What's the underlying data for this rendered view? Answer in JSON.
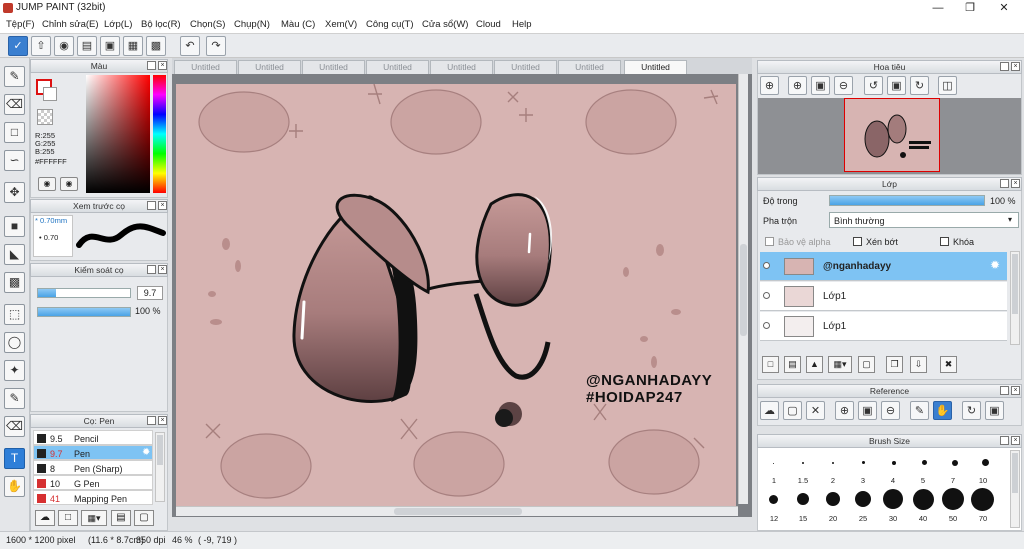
{
  "app": {
    "title": "JUMP PAINT (32bit)"
  },
  "menu": [
    "Tệp(F)",
    "Chỉnh sửa(E)",
    "Lớp(L)",
    "Bộ lọc(R)",
    "Chọn(S)",
    "Chụp(N)",
    "Màu (C)",
    "Xem(V)",
    "Công cụ(T)",
    "Cửa sổ(W)",
    "Cloud",
    "Help"
  ],
  "color_panel": {
    "title": "Màu",
    "r": "R:255",
    "g": "G:255",
    "b": "B:255",
    "hex": "#FFFFFF"
  },
  "preview_panel": {
    "title": "Xem trước cọ",
    "size": "* 0.70mm",
    "dot": "• 0.70"
  },
  "brush_control": {
    "title": "Kiểm soát cọ",
    "size_value": "9.7",
    "opacity_value": "100 %"
  },
  "brush_list": {
    "title": "Cọ: Pen",
    "items": [
      {
        "size": "9.5",
        "name": "Pencil",
        "color": "#222222"
      },
      {
        "size": "9.7",
        "name": "Pen",
        "color": "#d63031",
        "selected": true
      },
      {
        "size": "8",
        "name": "Pen (Sharp)",
        "color": "#222222"
      },
      {
        "size": "10",
        "name": "G Pen",
        "color": "#d63031"
      },
      {
        "size": "41",
        "name": "Mapping Pen",
        "color": "#d63031"
      }
    ]
  },
  "tabs": [
    "Untitled",
    "Untitled",
    "Untitled",
    "Untitled",
    "Untitled",
    "Untitled",
    "Untitled",
    "Untitled"
  ],
  "artwork": {
    "text_line1": "@NGANHADAYY",
    "text_line2": "#HOIDAP247"
  },
  "navigator": {
    "title": "Hoa tiêu"
  },
  "layer_panel": {
    "title": "Lớp",
    "opacity_label": "Độ trong",
    "opacity_value": "100 %",
    "blend_label": "Pha trộn",
    "blend_value": "Bình thường",
    "protect_alpha": "Bảo vệ alpha",
    "clipping": "Xén bớt",
    "lock": "Khóa",
    "layers": [
      {
        "name": "@nganhadayy",
        "selected": true
      },
      {
        "name": "Lớp1",
        "selected": false
      },
      {
        "name": "Lớp1",
        "selected": false
      }
    ]
  },
  "reference_panel": {
    "title": "Reference"
  },
  "brush_size_panel": {
    "title": "Brush Size",
    "row1": [
      "1",
      "1.5",
      "2",
      "3",
      "4",
      "5",
      "7",
      "10"
    ],
    "row2": [
      "12",
      "15",
      "20",
      "25",
      "30",
      "40",
      "50",
      "70"
    ]
  },
  "status": {
    "dimensions": "1600 * 1200 pixel",
    "physical": "(11.6 * 8.7cm)",
    "dpi": "350 dpi",
    "zoom": "46 %",
    "cursor": "( -9, 719 )"
  },
  "colors": {
    "accent": "#2f7fd8",
    "canvas_bg": "#d7b4b2",
    "selected_layer": "#7ec3f3"
  }
}
